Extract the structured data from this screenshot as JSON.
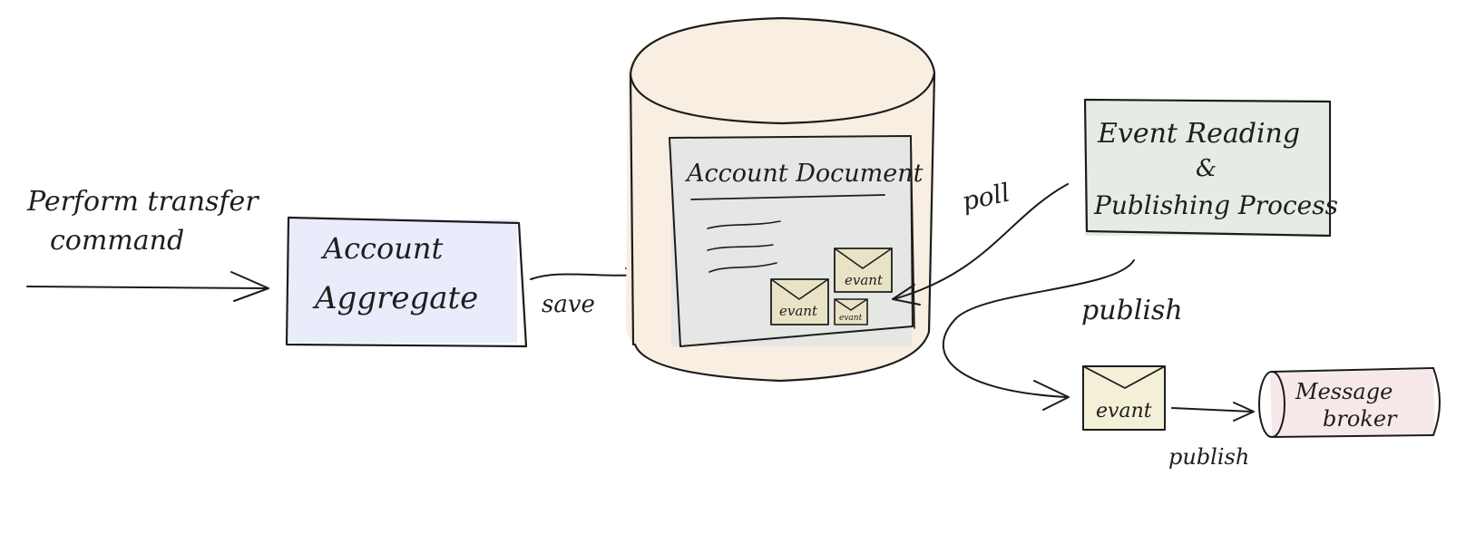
{
  "command": {
    "line1": "Perform transfer",
    "line2": "command"
  },
  "aggregate": {
    "line1": "Account",
    "line2": "Aggregate",
    "fill": "#e9edfb"
  },
  "save_label": "save",
  "database": {
    "document_title": "Account Document",
    "event_labels": [
      "evant",
      "evant",
      "evant"
    ],
    "cylinder_fill": "#f8efe2",
    "document_fill": "#e4e7e4"
  },
  "poll_label": "poll",
  "process": {
    "line1": "Event Reading",
    "line2": "&",
    "line3": "Publishing Process",
    "fill": "#e6ebe6"
  },
  "publish_label": "publish",
  "event_out": {
    "label": "evant",
    "fill": "#f4efd7"
  },
  "publish_label_2": "publish",
  "broker": {
    "line1": "Message",
    "line2": "broker",
    "fill": "#f7e9e9"
  },
  "envelope_fill": "#e8e3c4"
}
